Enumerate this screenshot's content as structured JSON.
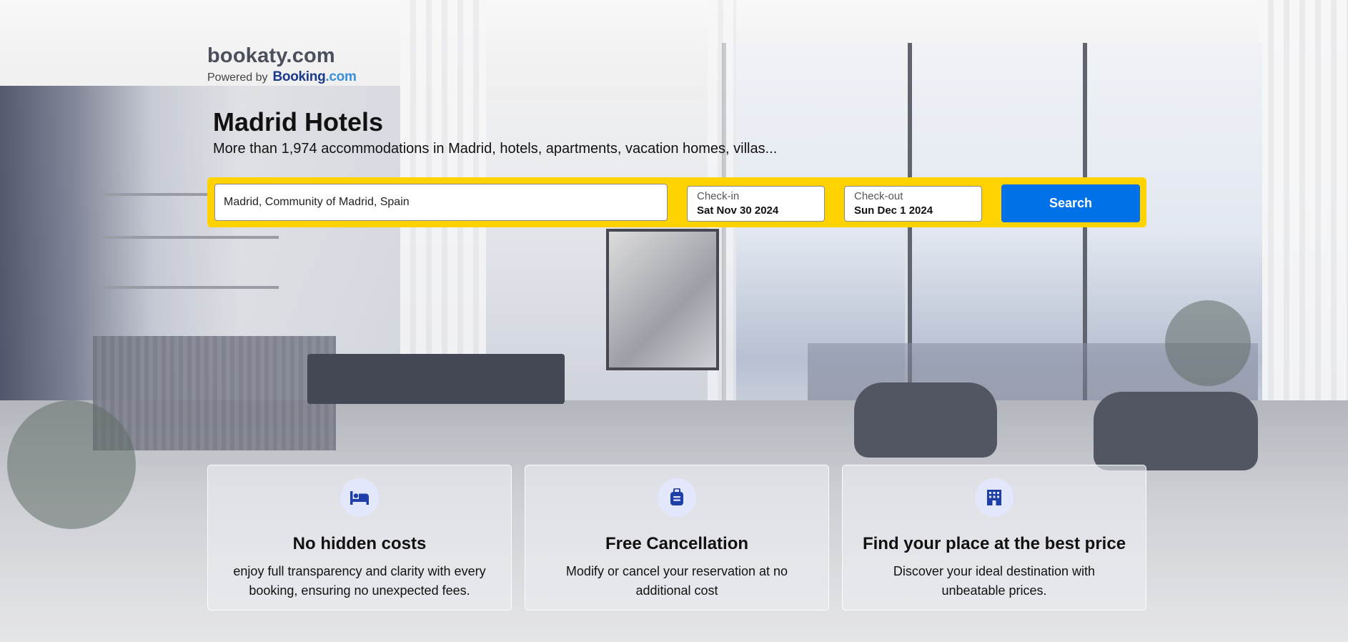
{
  "brand": {
    "name": "bookaty.com",
    "powered_label": "Powered by",
    "partner_logo_main": "Booking",
    "partner_logo_suffix": ".com"
  },
  "hero": {
    "title": "Madrid Hotels",
    "subtitle": "More than 1,974 accommodations in Madrid, hotels, apartments, vacation homes, villas..."
  },
  "search": {
    "destination_value": "Madrid, Community of Madrid, Spain",
    "checkin_label": "Check-in",
    "checkin_value": "Sat Nov 30 2024",
    "checkout_label": "Check-out",
    "checkout_value": "Sun Dec 1 2024",
    "button_label": "Search"
  },
  "features": [
    {
      "icon": "bed-icon",
      "title": "No hidden costs",
      "text": "enjoy full transparency and clarity with every booking, ensuring no unexpected fees."
    },
    {
      "icon": "luggage-icon",
      "title": "Free Cancellation",
      "text": "Modify or cancel your reservation at no additional cost"
    },
    {
      "icon": "hotel-building-icon",
      "title": "Find your place at the best price",
      "text": "Discover your ideal destination with unbeatable prices."
    }
  ],
  "colors": {
    "search_bar": "#ffd200",
    "search_button": "#0071e8",
    "icon_color": "#1f3fa8",
    "icon_badge": "#e3e7fb"
  }
}
